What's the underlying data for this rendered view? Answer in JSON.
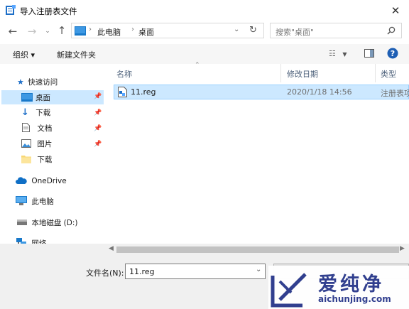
{
  "window": {
    "title": "导入注册表文件"
  },
  "nav": {
    "breadcrumb": [
      "此电脑",
      "桌面"
    ],
    "search_placeholder": "搜索\"桌面\""
  },
  "toolbar": {
    "organize_label": "组织 ▾",
    "new_folder_label": "新建文件夹"
  },
  "sidebar": {
    "quick_access": "快速访问",
    "items": [
      {
        "label": "桌面"
      },
      {
        "label": "下载"
      },
      {
        "label": "文档"
      },
      {
        "label": "图片"
      },
      {
        "label": "下载"
      }
    ],
    "onedrive": "OneDrive",
    "this_pc": "此电脑",
    "local_disk": "本地磁盘 (D:)",
    "network": "网络"
  },
  "columns": {
    "name": "名称",
    "modified": "修改日期",
    "type": "类型"
  },
  "files": [
    {
      "name": "11.reg",
      "modified": "2020/1/18 14:56",
      "type": "注册表项"
    }
  ],
  "footer": {
    "filename_label": "文件名(N):",
    "filename_value": "11.reg"
  },
  "watermark": {
    "brand": "爱纯净",
    "url": "aichunjing.com"
  },
  "colors": {
    "selection": "#cce8ff",
    "accent": "#0078d7",
    "help": "#1e5fb4"
  }
}
